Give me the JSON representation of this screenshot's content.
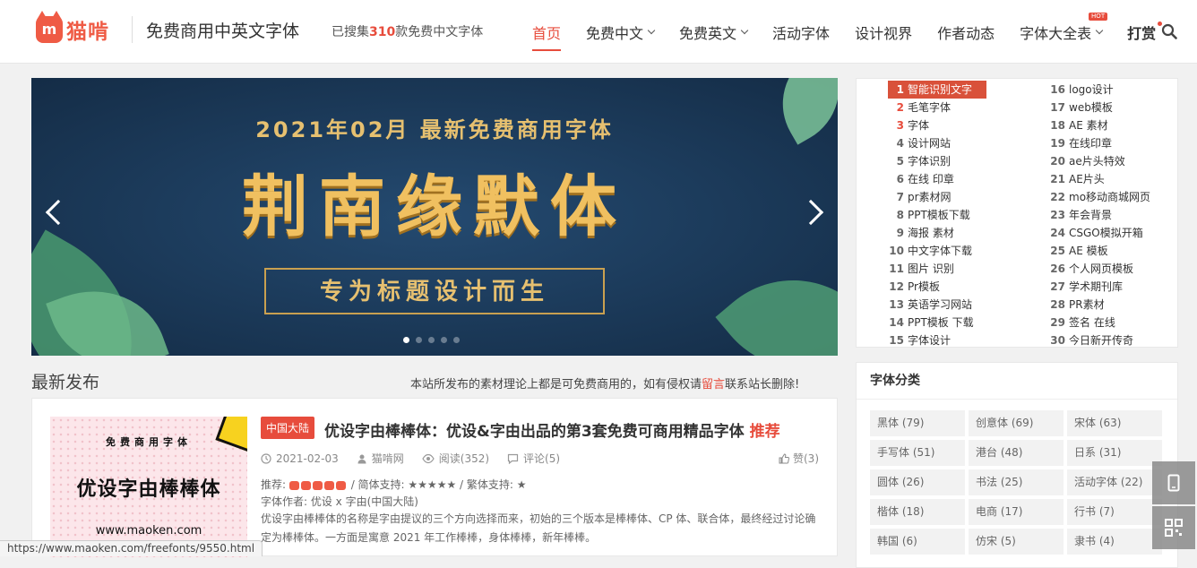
{
  "header": {
    "logo_text": "猫啃",
    "logo_mark": "m",
    "site_title": "免费商用中英文字体",
    "stats_prefix": "已搜集",
    "stats_count": "310",
    "stats_suffix": "款免费中文字体",
    "nav": [
      {
        "label": "首页"
      },
      {
        "label": "免费中文"
      },
      {
        "label": "免费英文"
      },
      {
        "label": "活动字体"
      },
      {
        "label": "设计视界"
      },
      {
        "label": "作者动态"
      },
      {
        "label": "字体大全表"
      },
      {
        "label": "打赏"
      }
    ],
    "hot_badge": "HOT"
  },
  "banner": {
    "subtitle": "2021年02月 最新免费商用字体",
    "title": "荆南缘默体",
    "tagline": "专为标题设计而生"
  },
  "latest": {
    "title": "最新发布",
    "note_prefix": "本站所发布的素材理论上都是可免费商用的，如有侵权请",
    "note_link": "留言",
    "note_suffix": "联系站长删除!"
  },
  "post": {
    "thumb_top": "免费商用字体",
    "thumb_title": "优设字由棒棒体",
    "thumb_url": "www.maoken.com",
    "region": "中国大陆",
    "title": "优设字由棒棒体：优设&字由出品的第3套免费可商用精品字体",
    "recommend": "推荐",
    "date": "2021-02-03",
    "author": "猫啃网",
    "views": "阅读(352)",
    "comments": "评论(5)",
    "likes": "赞(3)",
    "rating_label": "推荐:",
    "rating_rest": "/ 简体支持: ★★★★★ / 繁体支持: ★",
    "font_author": "字体作者: 优设 x 字由(中国大陆)",
    "description": "优设字由棒棒体的名称是字由提议的三个方向选择而来，初始的三个版本是棒棒体、CP 体、联合体，最终经过讨论确定为棒棒体。一方面是寓意 2021 年工作棒棒，身体棒棒，新年棒棒。"
  },
  "hotlist": {
    "col1": [
      {
        "n": "1",
        "t": "智能识别文字"
      },
      {
        "n": "2",
        "t": "毛笔字体"
      },
      {
        "n": "3",
        "t": "字体"
      },
      {
        "n": "4",
        "t": "设计网站"
      },
      {
        "n": "5",
        "t": "字体识别"
      },
      {
        "n": "6",
        "t": "在线 印章"
      },
      {
        "n": "7",
        "t": "pr素材网"
      },
      {
        "n": "8",
        "t": "PPT模板下载"
      },
      {
        "n": "9",
        "t": "海报 素材"
      },
      {
        "n": "10",
        "t": "中文字体下载"
      },
      {
        "n": "11",
        "t": "图片 识别"
      },
      {
        "n": "12",
        "t": "Pr模板"
      },
      {
        "n": "13",
        "t": "英语学习网站"
      },
      {
        "n": "14",
        "t": "PPT模板 下载"
      },
      {
        "n": "15",
        "t": "字体设计"
      }
    ],
    "col2": [
      {
        "n": "16",
        "t": "logo设计"
      },
      {
        "n": "17",
        "t": "web模板"
      },
      {
        "n": "18",
        "t": "AE 素材"
      },
      {
        "n": "19",
        "t": "在线印章"
      },
      {
        "n": "20",
        "t": "ae片头特效"
      },
      {
        "n": "21",
        "t": "AE片头"
      },
      {
        "n": "22",
        "t": "mo移动商城网页"
      },
      {
        "n": "23",
        "t": "年会背景"
      },
      {
        "n": "24",
        "t": "CSGO模拟开箱"
      },
      {
        "n": "25",
        "t": "AE 模板"
      },
      {
        "n": "26",
        "t": "个人网页模板"
      },
      {
        "n": "27",
        "t": "学术期刊库"
      },
      {
        "n": "28",
        "t": "PR素材"
      },
      {
        "n": "29",
        "t": "签名 在线"
      },
      {
        "n": "30",
        "t": "今日新开传奇"
      }
    ]
  },
  "categories": {
    "title": "字体分类",
    "items": [
      "黑体 (79)",
      "创意体 (69)",
      "宋体 (63)",
      "手写体 (51)",
      "港台 (48)",
      "日系 (31)",
      "圆体 (26)",
      "书法 (25)",
      "活动字体 (22)",
      "楷体 (18)",
      "电商 (17)",
      "行书 (7)",
      "韩国 (6)",
      "仿宋 (5)",
      "隶书 (4)"
    ]
  },
  "statusbar": "https://www.maoken.com/freefonts/9550.html",
  "colors": {
    "accent": "#e74c3c",
    "banner_bg": "#1b3a5a",
    "gold": "#f0c060"
  }
}
